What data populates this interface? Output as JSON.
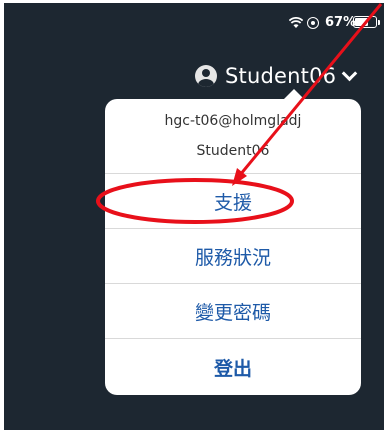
{
  "status_bar": {
    "battery_percent": "67%",
    "battery_level": 0.67,
    "icons": [
      "wifi-icon",
      "orientation-lock-icon",
      "battery-icon"
    ]
  },
  "header": {
    "user_name": "Student06"
  },
  "menu": {
    "email": "hgc-t06@holmgladj",
    "user": "Student06",
    "items": [
      {
        "label": "支援"
      },
      {
        "label": "服務狀況"
      },
      {
        "label": "變更密碼"
      },
      {
        "label": "登出"
      }
    ]
  },
  "annotation": {
    "color": "#e8101a"
  }
}
